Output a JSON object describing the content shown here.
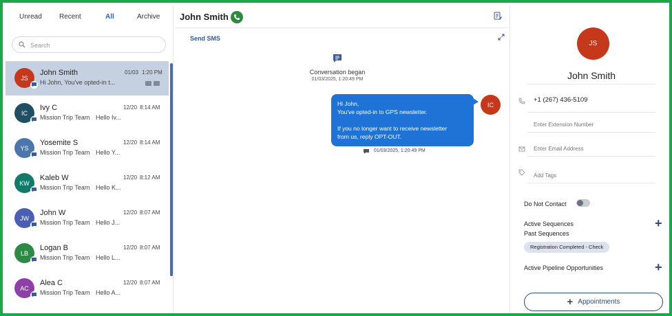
{
  "tabs": [
    {
      "label": "Unread"
    },
    {
      "label": "Recent"
    },
    {
      "label": "All"
    },
    {
      "label": "Archive"
    }
  ],
  "search": {
    "placeholder": "Search"
  },
  "conversations": [
    {
      "initials": "JS",
      "color": "#c5381c",
      "name": "John Smith",
      "date": "01/03",
      "time": "1:20 PM",
      "subtitle": "",
      "snippet": "Hi John,  You've opted-in t..."
    },
    {
      "initials": "IC",
      "color": "#1f4f63",
      "name": "Ivy C",
      "date": "12/20",
      "time": "8:14 AM",
      "subtitle": "Mission Trip Team",
      "snippet": "Hello Iv..."
    },
    {
      "initials": "YS",
      "color": "#4a77ad",
      "name": "Yosemite S",
      "date": "12/20",
      "time": "8:14 AM",
      "subtitle": "Mission Trip Team",
      "snippet": "Hello Y..."
    },
    {
      "initials": "KW",
      "color": "#117a6b",
      "name": "Kaleb W",
      "date": "12/20",
      "time": "8:12 AM",
      "subtitle": "Mission Trip Team",
      "snippet": "Hello K..."
    },
    {
      "initials": "JW",
      "color": "#4a5fb4",
      "name": "John W",
      "date": "12/20",
      "time": "8:07 AM",
      "subtitle": "Mission Trip Team",
      "snippet": "Hello J..."
    },
    {
      "initials": "LB",
      "color": "#2c8a44",
      "name": "Logan B",
      "date": "12/20",
      "time": "8:07 AM",
      "subtitle": "Mission Trip Team",
      "snippet": "Hello L..."
    },
    {
      "initials": "AC",
      "color": "#8e3fa8",
      "name": "Alea C",
      "date": "12/20",
      "time": "8:07 AM",
      "subtitle": "Mission Trip Team",
      "snippet": "Hello A..."
    }
  ],
  "header": {
    "contact_name": "John Smith"
  },
  "send_sms_label": "Send SMS",
  "conversation_start": {
    "text": "Conversation began",
    "date": "01/03/2025, 1:20:49 PM"
  },
  "message": {
    "lines": [
      "Hi John,",
      "You've opted-in to GPS newsletter.",
      "If you no longer want to receive newsletter",
      "from us, reply OPT-OUT."
    ],
    "timestamp": "01/03/2025, 1:20:49 PM",
    "sender_initials": "IC"
  },
  "contact": {
    "initials": "JS",
    "name": "John Smith",
    "phone": "+1 (267) 436-5109",
    "extension_placeholder": "Enter Extension Number",
    "email_placeholder": "Enter Email Address",
    "tags_placeholder": "Add Tags",
    "do_not_contact_label": "Do Not Contact",
    "active_sequences_label": "Active Sequences",
    "past_sequences_label": "Past Sequences",
    "past_sequence_chip": "Registration Completed - Check",
    "pipeline_label": "Active Pipeline Opportunities",
    "appointments_label": "Appointments"
  },
  "colors": {
    "accent": "#2b63c4",
    "bubble": "#1f73d6",
    "border": "#1aa84a"
  }
}
